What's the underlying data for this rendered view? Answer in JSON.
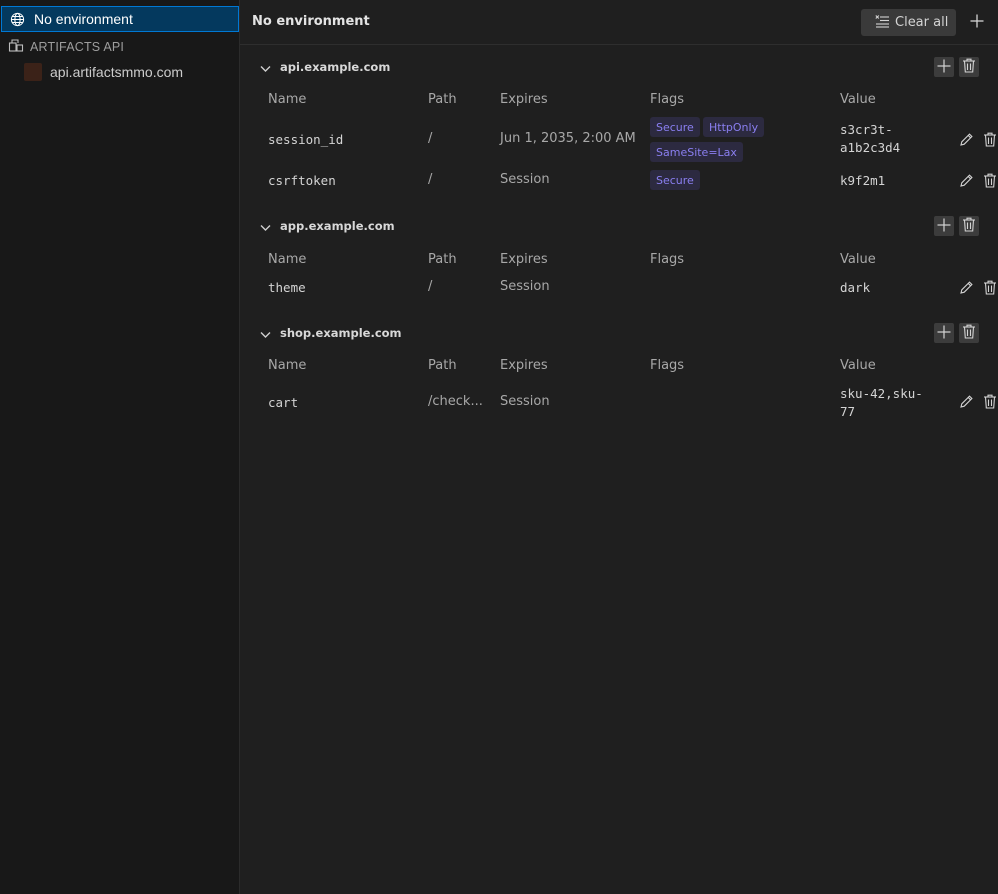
{
  "sidebar": {
    "selected_env": "No environment",
    "group_label": "ARTIFACTS API",
    "child_env": "api.artifactsmmo.com"
  },
  "topbar": {
    "title": "No environment",
    "clear_all": "Clear all"
  },
  "columns": {
    "name": "Name",
    "path": "Path",
    "expires": "Expires",
    "flags": "Flags",
    "value": "Value"
  },
  "domains": [
    {
      "name": "api.example.com",
      "cookies": [
        {
          "name": "session_id",
          "path": "/",
          "expires": "Jun 1, 2035, 2:00 AM",
          "flags": [
            "Secure",
            "HttpOnly",
            "SameSite=Lax"
          ],
          "value": "s3cr3t-a1b2c3d4",
          "value_lines": [
            "s3cr3t-",
            "a1b2c3d4"
          ]
        },
        {
          "name": "csrftoken",
          "path": "/",
          "expires": "Session",
          "flags": [
            "Secure"
          ],
          "value": "k9f2m1",
          "value_lines": [
            "k9f2m1"
          ]
        }
      ]
    },
    {
      "name": "app.example.com",
      "cookies": [
        {
          "name": "theme",
          "path": "/",
          "expires": "Session",
          "flags": [],
          "value": "dark",
          "value_lines": [
            "dark"
          ]
        }
      ]
    },
    {
      "name": "shop.example.com",
      "cookies": [
        {
          "name": "cart",
          "path": "/check...",
          "expires": "Session",
          "flags": [],
          "value": "sku-42,sku-77",
          "value_lines": [
            "sku-42,sku-",
            "77"
          ]
        }
      ]
    }
  ],
  "icons": {
    "selected_env": "globe-icon",
    "group": "collection-icon",
    "clear_all": "clear-list-icon",
    "add": "plus-icon",
    "expand": "chevron-down-icon",
    "delete": "trash-icon",
    "edit": "pencil-icon"
  },
  "colors": {
    "selection_bg": "#04395e",
    "selection_border": "#0078d4",
    "badge_text": "#8a7ff0",
    "badge_bg": "#2c2a40"
  }
}
